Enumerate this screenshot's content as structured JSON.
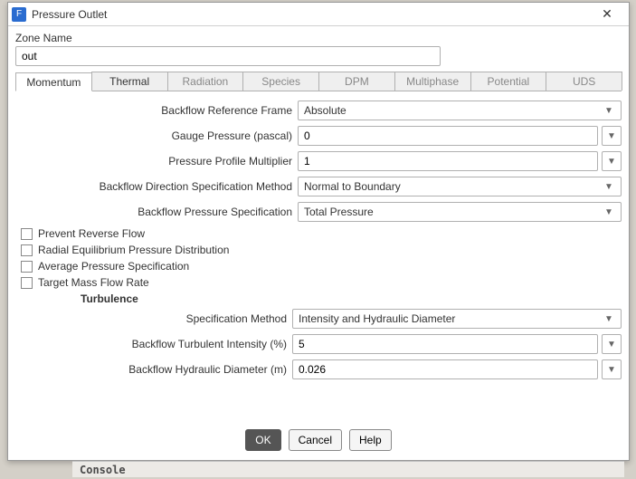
{
  "window": {
    "title": "Pressure Outlet",
    "icon_letter": "F",
    "close_glyph": "✕"
  },
  "zone": {
    "label": "Zone Name",
    "value": "out"
  },
  "tabs": [
    {
      "label": "Momentum",
      "active": true,
      "enabled": true
    },
    {
      "label": "Thermal",
      "active": false,
      "enabled": true
    },
    {
      "label": "Radiation",
      "active": false,
      "enabled": false
    },
    {
      "label": "Species",
      "active": false,
      "enabled": false
    },
    {
      "label": "DPM",
      "active": false,
      "enabled": false
    },
    {
      "label": "Multiphase",
      "active": false,
      "enabled": false
    },
    {
      "label": "Potential",
      "active": false,
      "enabled": false
    },
    {
      "label": "UDS",
      "active": false,
      "enabled": false
    }
  ],
  "fields": {
    "ref_frame": {
      "label": "Backflow Reference Frame",
      "value": "Absolute"
    },
    "gauge_press": {
      "label": "Gauge Pressure (pascal)",
      "value": "0"
    },
    "profile_mult": {
      "label": "Pressure Profile Multiplier",
      "value": "1"
    },
    "dir_spec": {
      "label": "Backflow Direction Specification Method",
      "value": "Normal to Boundary"
    },
    "press_spec": {
      "label": "Backflow Pressure Specification",
      "value": "Total Pressure"
    }
  },
  "checks": {
    "prevent": {
      "label": "Prevent Reverse Flow",
      "checked": false
    },
    "radial": {
      "label": "Radial Equilibrium Pressure Distribution",
      "checked": false
    },
    "avg": {
      "label": "Average Pressure Specification",
      "checked": false
    },
    "target": {
      "label": "Target Mass Flow Rate",
      "checked": false
    }
  },
  "turbulence": {
    "title": "Turbulence",
    "spec_method": {
      "label": "Specification Method",
      "value": "Intensity and Hydraulic Diameter"
    },
    "intensity": {
      "label": "Backflow Turbulent Intensity (%)",
      "value": "5"
    },
    "hyd_diam": {
      "label": "Backflow Hydraulic Diameter (m)",
      "value": "0.026"
    }
  },
  "buttons": {
    "ok": "OK",
    "cancel": "Cancel",
    "help": "Help"
  },
  "console_label": "Console"
}
